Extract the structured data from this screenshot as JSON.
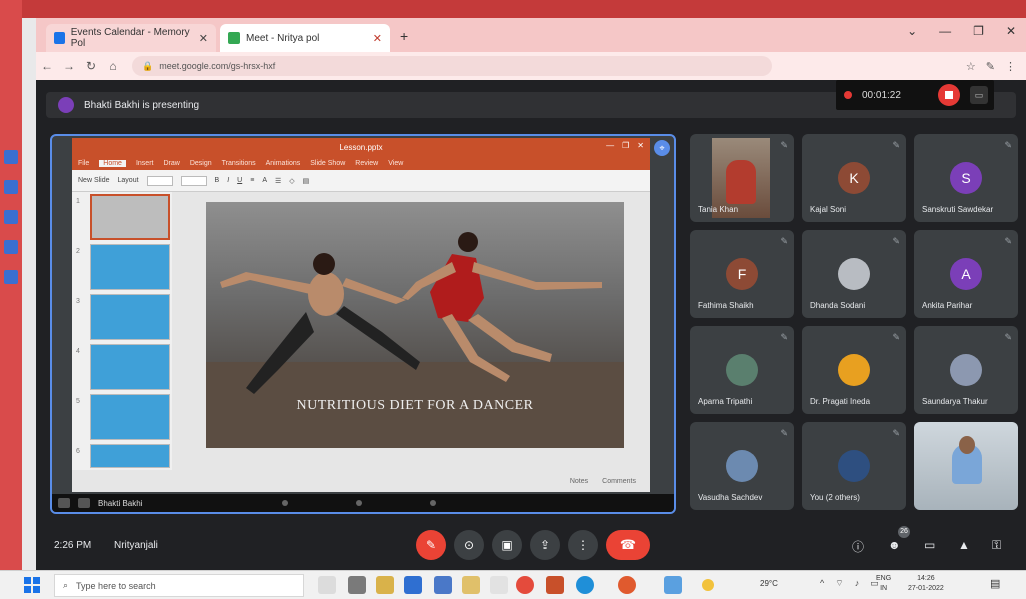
{
  "browser": {
    "tabs": [
      {
        "label": "Events Calendar - Memory Pol",
        "color": "#1a73e8"
      },
      {
        "label": "Meet - Nritya pol",
        "color": "#34a853"
      }
    ],
    "new_tab": "+",
    "window_controls": [
      "⌄",
      "—",
      "❐",
      "✕"
    ],
    "url": "meet.google.com/gs-hrsx-hxf",
    "addr_icons": [
      "☆",
      "✎",
      "⋮"
    ]
  },
  "meet": {
    "recording": {
      "time": "00:01:22"
    },
    "presenting_banner": "Bhakti Bakhi is presenting",
    "presentation": {
      "app_title": "Lesson.pptx",
      "menu": [
        "File",
        "Home",
        "Insert",
        "Draw",
        "Design",
        "Transitions",
        "Animations",
        "Slide Show",
        "Review",
        "View"
      ],
      "active_menu": "Home",
      "ribbon": [
        "New Slide",
        "Layout",
        "Font",
        "Font Size"
      ],
      "thumb_numbers": [
        "1",
        "2",
        "3",
        "4",
        "5",
        "6"
      ],
      "slide_title": "NUTRITIOUS DIET FOR A DANCER",
      "status": [
        "Notes",
        "Comments"
      ],
      "presenter_label": "Bhakti Bakhi"
    },
    "participants": [
      {
        "name": "Tania Khan",
        "type": "selfcam"
      },
      {
        "name": "Kajal Soni",
        "initial": "K",
        "color": "#8d4a35"
      },
      {
        "name": "Sanskruti Sawdekar",
        "initial": "S",
        "color": "#7b3fb8"
      },
      {
        "name": "Fathima Shaikh",
        "initial": "F",
        "color": "#8d4a35"
      },
      {
        "name": "Dhanda Sodani",
        "photo": "#b8bcc2"
      },
      {
        "name": "Ankita Parihar",
        "initial": "A",
        "color": "#7b3fb8"
      },
      {
        "name": "Aparna Tripathi",
        "photo": "#5a7f6e"
      },
      {
        "name": "Dr. Pragati Ineda",
        "photo": "#e8a020"
      },
      {
        "name": "Saundarya Thakur",
        "photo": "#8c98b0"
      },
      {
        "name": "Vasudha Sachdev",
        "photo": "#6c8ab0"
      },
      {
        "name": "You (2 others)",
        "photo": "#2e4f80"
      },
      {
        "name": "",
        "type": "video"
      }
    ],
    "controls": {
      "clock": "2:26 PM",
      "meeting_name": "Nrityanjali",
      "buttons": [
        "mic-off",
        "camera",
        "captions",
        "present",
        "more"
      ],
      "right_icons": [
        "info",
        "people",
        "chat",
        "activities",
        "lock"
      ],
      "people_count": "26"
    }
  },
  "taskbar": {
    "search_placeholder": "Type here to search",
    "temperature": "29°C",
    "lang": "ENG\nIN",
    "time": "14:26",
    "date": "27-01-2022"
  }
}
